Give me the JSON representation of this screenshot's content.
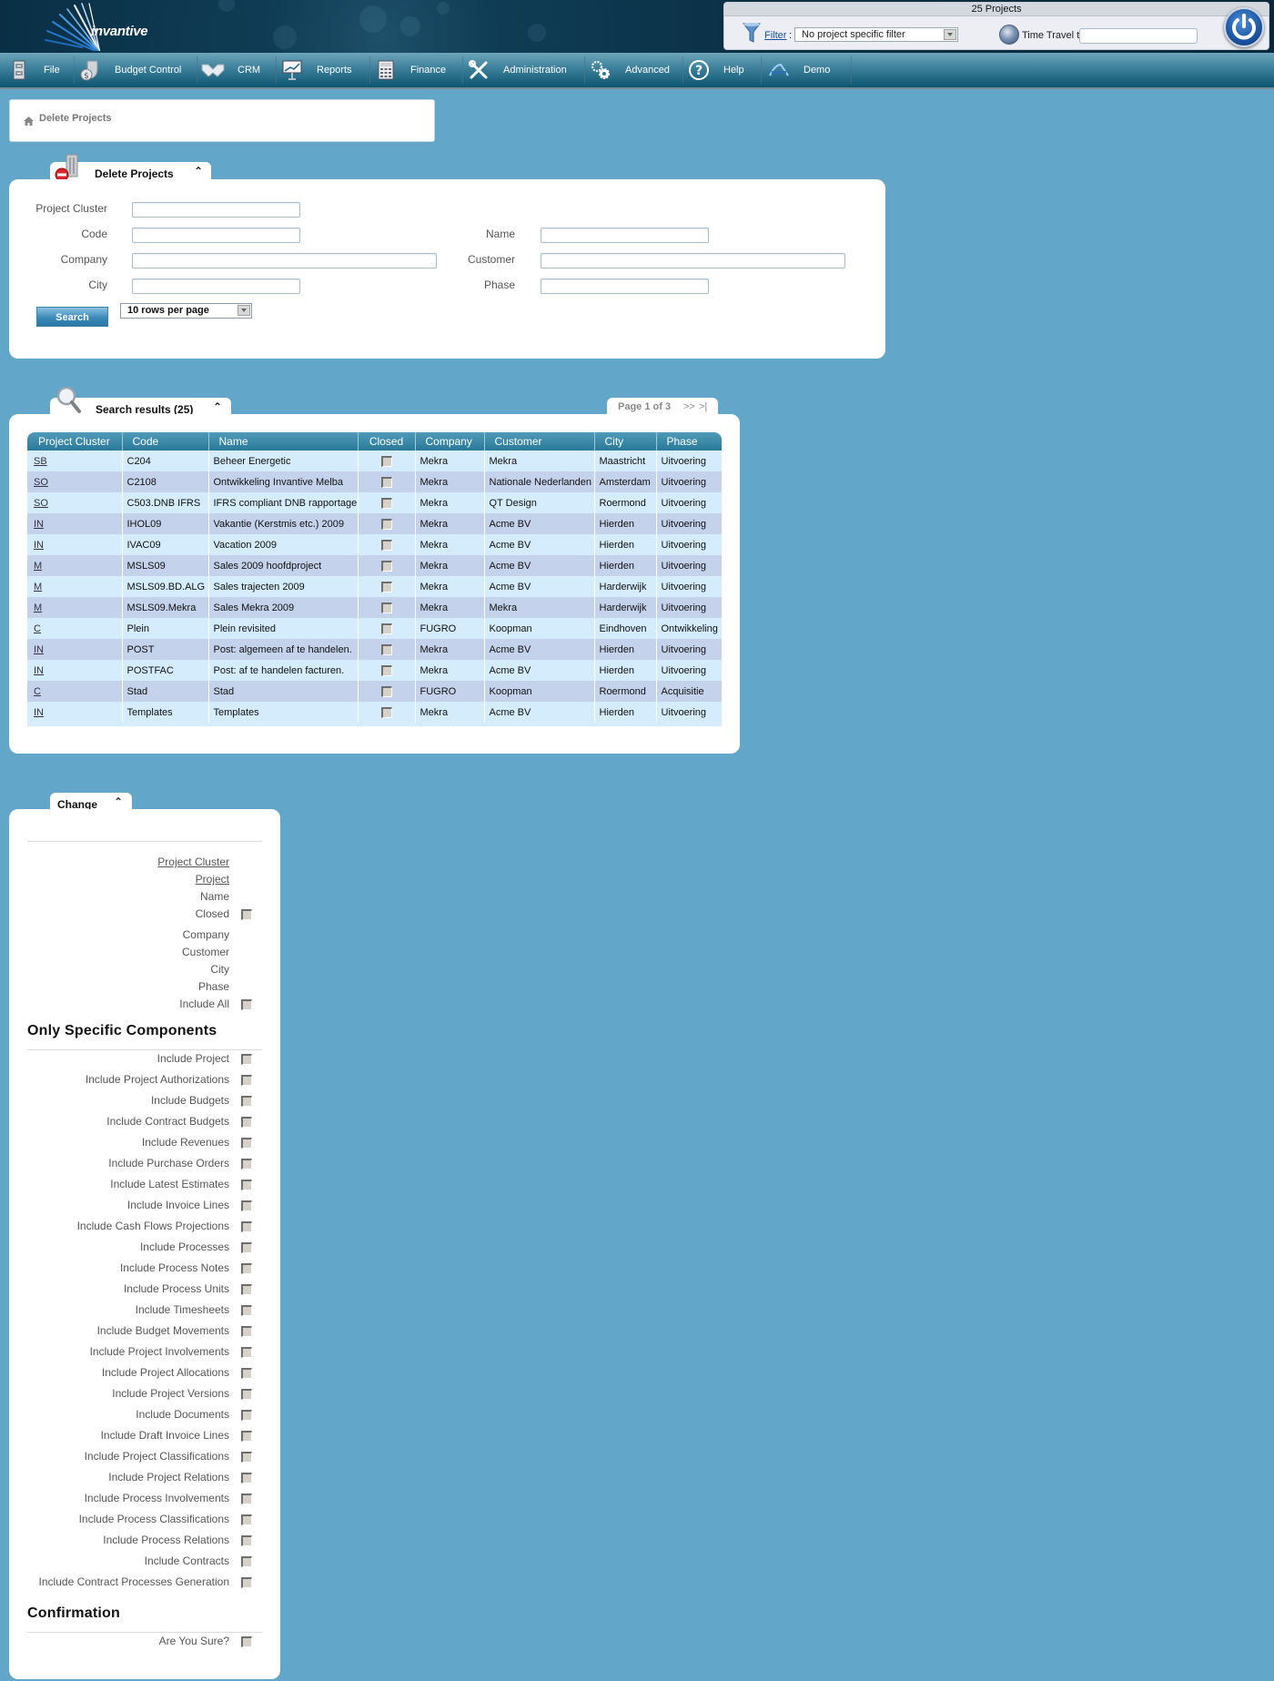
{
  "header": {
    "logo_text": "invantive",
    "project_count": "25 Projects",
    "filter_link": "Filter",
    "filter_colon": ":",
    "filter_value": "No project specific filter",
    "time_travel_label": "Time Travel to:",
    "time_travel_value": ""
  },
  "nav": {
    "items": [
      {
        "label": "File",
        "icon": "file-cabinet-icon"
      },
      {
        "label": "Budget Control",
        "icon": "money-shield-icon"
      },
      {
        "label": "CRM",
        "icon": "handshake-icon"
      },
      {
        "label": "Reports",
        "icon": "presentation-chart-icon"
      },
      {
        "label": "Finance",
        "icon": "calculator-icon"
      },
      {
        "label": "Administration",
        "icon": "tools-icon"
      },
      {
        "label": "Advanced",
        "icon": "gears-icon"
      },
      {
        "label": "Help",
        "icon": "help-icon"
      },
      {
        "label": "Demo",
        "icon": "demo-logo-icon"
      }
    ]
  },
  "breadcrumb": {
    "label": "Delete Projects"
  },
  "search_panel": {
    "title": "Delete Projects",
    "fields": {
      "project_cluster": {
        "label": "Project Cluster",
        "value": ""
      },
      "code": {
        "label": "Code",
        "value": ""
      },
      "name": {
        "label": "Name",
        "value": ""
      },
      "company": {
        "label": "Company",
        "value": ""
      },
      "customer": {
        "label": "Customer",
        "value": ""
      },
      "city": {
        "label": "City",
        "value": ""
      },
      "phase": {
        "label": "Phase",
        "value": ""
      }
    },
    "search_button": "Search",
    "rows_per_page": "10 rows per page"
  },
  "results": {
    "title": "Search results (25)",
    "pager": {
      "label": "Page 1 of 3",
      "next": ">>",
      "last": ">|"
    },
    "columns": [
      "Project Cluster",
      "Code",
      "Name",
      "Closed",
      "Company",
      "Customer",
      "City",
      "Phase"
    ],
    "rows": [
      {
        "cluster": "SB",
        "code": "C204",
        "name": "Beheer Energetic",
        "closed": false,
        "company": "Mekra",
        "customer": "Mekra",
        "city": "Maastricht",
        "phase": "Uitvoering"
      },
      {
        "cluster": "SO",
        "code": "C2108",
        "name": "Ontwikkeling Invantive Melba",
        "closed": false,
        "company": "Mekra",
        "customer": "Nationale Nederlanden",
        "city": "Amsterdam",
        "phase": "Uitvoering"
      },
      {
        "cluster": "SO",
        "code": "C503.DNB IFRS",
        "name": "IFRS compliant DNB rapportage",
        "closed": false,
        "company": "Mekra",
        "customer": "QT Design",
        "city": "Roermond",
        "phase": "Uitvoering"
      },
      {
        "cluster": "IN",
        "code": "IHOL09",
        "name": "Vakantie (Kerstmis etc.) 2009",
        "closed": false,
        "company": "Mekra",
        "customer": "Acme BV",
        "city": "Hierden",
        "phase": "Uitvoering"
      },
      {
        "cluster": "IN",
        "code": "IVAC09",
        "name": "Vacation 2009",
        "closed": false,
        "company": "Mekra",
        "customer": "Acme BV",
        "city": "Hierden",
        "phase": "Uitvoering"
      },
      {
        "cluster": "M",
        "code": "MSLS09",
        "name": "Sales 2009 hoofdproject",
        "closed": false,
        "company": "Mekra",
        "customer": "Acme BV",
        "city": "Hierden",
        "phase": "Uitvoering"
      },
      {
        "cluster": "M",
        "code": "MSLS09.BD.ALG",
        "name": "Sales trajecten 2009",
        "closed": false,
        "company": "Mekra",
        "customer": "Acme BV",
        "city": "Harderwijk",
        "phase": "Uitvoering"
      },
      {
        "cluster": "M",
        "code": "MSLS09.Mekra",
        "name": "Sales Mekra 2009",
        "closed": false,
        "company": "Mekra",
        "customer": "Mekra",
        "city": "Harderwijk",
        "phase": "Uitvoering"
      },
      {
        "cluster": "C",
        "code": "Plein",
        "name": "Plein revisited",
        "closed": false,
        "company": "FUGRO",
        "customer": "Koopman",
        "city": "Eindhoven",
        "phase": "Ontwikkeling"
      },
      {
        "cluster": "IN",
        "code": "POST",
        "name": "Post: algemeen af te handelen.",
        "closed": false,
        "company": "Mekra",
        "customer": "Acme BV",
        "city": "Hierden",
        "phase": "Uitvoering"
      },
      {
        "cluster": "IN",
        "code": "POSTFAC",
        "name": "Post: af te handelen facturen.",
        "closed": false,
        "company": "Mekra",
        "customer": "Acme BV",
        "city": "Hierden",
        "phase": "Uitvoering"
      },
      {
        "cluster": "C",
        "code": "Stad",
        "name": "Stad",
        "closed": false,
        "company": "FUGRO",
        "customer": "Koopman",
        "city": "Roermond",
        "phase": "Acquisitie"
      },
      {
        "cluster": "IN",
        "code": "Templates",
        "name": "Templates",
        "closed": false,
        "company": "Mekra",
        "customer": "Acme BV",
        "city": "Hierden",
        "phase": "Uitvoering"
      }
    ]
  },
  "change_panel": {
    "title": "Change",
    "detail_fields": [
      {
        "label": "Project Cluster",
        "link": true,
        "checkbox": false
      },
      {
        "label": "Project",
        "link": true,
        "checkbox": false
      },
      {
        "label": "Name",
        "link": false,
        "checkbox": false
      },
      {
        "label": "Closed",
        "link": false,
        "checkbox": true,
        "checked": false
      },
      {
        "label": "Company",
        "link": false,
        "checkbox": false
      },
      {
        "label": "Customer",
        "link": false,
        "checkbox": false
      },
      {
        "label": "City",
        "link": false,
        "checkbox": false
      },
      {
        "label": "Phase",
        "link": false,
        "checkbox": false
      },
      {
        "label": "Include All",
        "link": false,
        "checkbox": true,
        "checked": false
      }
    ],
    "components_title": "Only Specific Components",
    "components": [
      {
        "label": "Include Project",
        "checked": false
      },
      {
        "label": "Include Project Authorizations",
        "checked": false
      },
      {
        "label": "Include Budgets",
        "checked": false
      },
      {
        "label": "Include Contract Budgets",
        "checked": false
      },
      {
        "label": "Include Revenues",
        "checked": false
      },
      {
        "label": "Include Purchase Orders",
        "checked": false
      },
      {
        "label": "Include Latest Estimates",
        "checked": false
      },
      {
        "label": "Include Invoice Lines",
        "checked": false
      },
      {
        "label": "Include Cash Flows Projections",
        "checked": false
      },
      {
        "label": "Include Processes",
        "checked": false
      },
      {
        "label": "Include Process Notes",
        "checked": false
      },
      {
        "label": "Include Process Units",
        "checked": false
      },
      {
        "label": "Include Timesheets",
        "checked": false
      },
      {
        "label": "Include Budget Movements",
        "checked": false
      },
      {
        "label": "Include Project Involvements",
        "checked": false
      },
      {
        "label": "Include Project Allocations",
        "checked": false
      },
      {
        "label": "Include Project Versions",
        "checked": false
      },
      {
        "label": "Include Documents",
        "checked": false
      },
      {
        "label": "Include Draft Invoice Lines",
        "checked": false
      },
      {
        "label": "Include Project Classifications",
        "checked": false
      },
      {
        "label": "Include Project Relations",
        "checked": false
      },
      {
        "label": "Include Process Involvements",
        "checked": false
      },
      {
        "label": "Include Process Classifications",
        "checked": false
      },
      {
        "label": "Include Process Relations",
        "checked": false
      },
      {
        "label": "Include Contracts",
        "checked": false
      },
      {
        "label": "Include Contract Processes Generation",
        "checked": false
      }
    ],
    "confirmation_title": "Confirmation",
    "confirmation": {
      "label": "Are You Sure?",
      "checked": false
    }
  },
  "colors": {
    "page_background": "#62a6c9",
    "nav_bar": "#2a7998",
    "table_header": "#2a7998",
    "row_odd": "#d4ecfc",
    "row_even": "#c5d2ec",
    "search_button": "#3b8ab8"
  }
}
